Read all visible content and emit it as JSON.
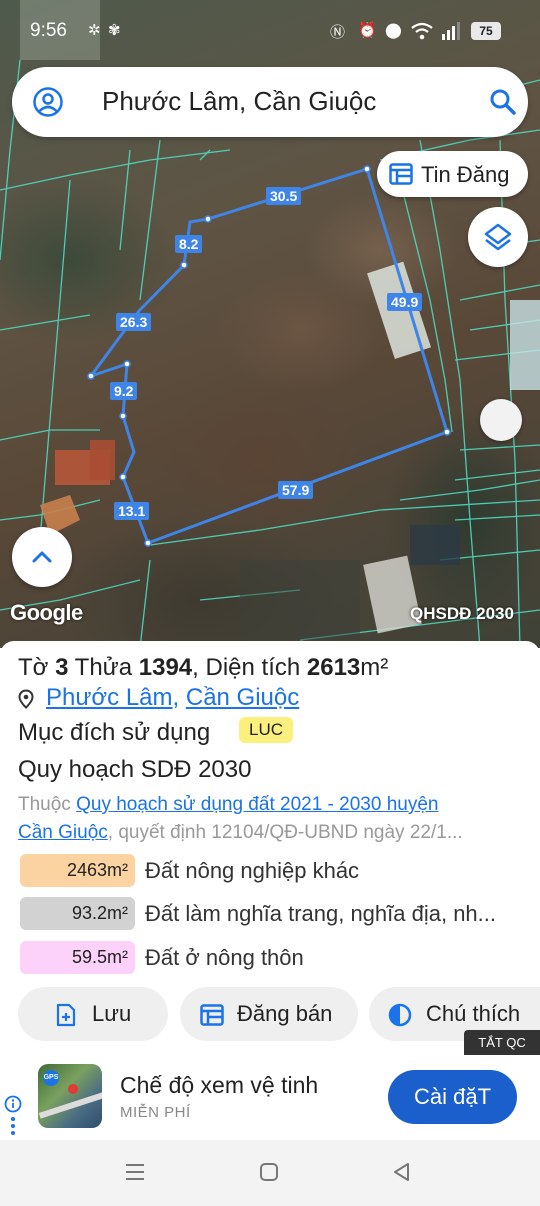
{
  "status": {
    "time": "9:56",
    "battery": "75"
  },
  "search": {
    "query": "Phước Lâm, Cần Giuộc"
  },
  "map": {
    "post_chip_label": "Tin Đăng",
    "google_label": "Google",
    "plan_label": "QHSDĐ 2030",
    "edges": [
      "30.5",
      "8.2",
      "26.3",
      "9.2",
      "13.1",
      "57.9",
      "49.9"
    ],
    "boundary_color": "#3f85e8"
  },
  "parcel": {
    "sheet_prefix": "Tờ",
    "sheet_no": "3",
    "lot_prefix": "Thửa",
    "lot_no": "1394",
    "area_prefix": ", Diện tích",
    "area_value": "2613",
    "area_unit": "m²",
    "ward": "Phước Lâm",
    "district": "Cần Giuộc",
    "purpose_label": "Mục đích sử dụng",
    "purpose_code": "LUC",
    "plan_title": "Quy hoạch SDĐ 2030",
    "belongs_prefix": "Thuộc ",
    "plan_link": "Quy hoạch sử dụng đất 2021 - 2030 huyện",
    "plan_link_cont": "Cần Giuộc",
    "decision": ", quyết định 12104/QĐ-UBND ngày 22/1..."
  },
  "legend": [
    {
      "area": "2463m²",
      "label": "Đất nông nghiệp khác",
      "color": "#fbd3a0"
    },
    {
      "area": "93.2m²",
      "label": "Đất làm nghĩa trang, nghĩa địa, nh...",
      "color": "#d2d2d2"
    },
    {
      "area": "59.5m²",
      "label": "Đất ở nông thôn",
      "color": "#fcd2fa"
    }
  ],
  "actions": {
    "save": "Lưu",
    "sell": "Đăng bán",
    "legend": "Chú thích"
  },
  "ad": {
    "tag": "TẮT QC",
    "title": "Chế độ xem vệ tinh",
    "subtitle": "MIỄN PHÍ",
    "install": "Cài đặT"
  }
}
